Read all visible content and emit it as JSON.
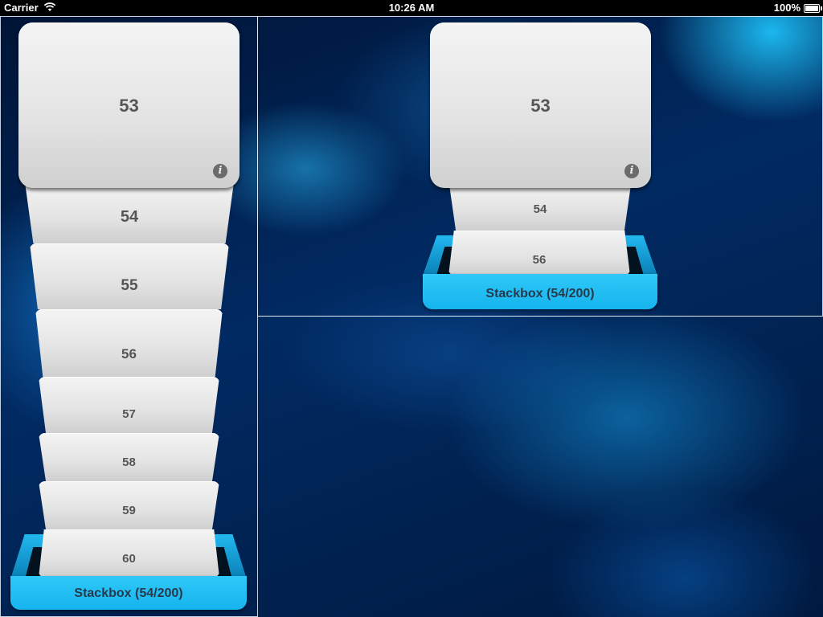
{
  "status_bar": {
    "carrier": "Carrier",
    "time": "10:26 AM",
    "battery": "100%"
  },
  "left_stack": {
    "cards": [
      {
        "label": "53"
      },
      {
        "label": "54"
      },
      {
        "label": "55"
      },
      {
        "label": "56"
      },
      {
        "label": "57"
      },
      {
        "label": "58"
      },
      {
        "label": "59"
      },
      {
        "label": "60"
      }
    ],
    "info_glyph": "i",
    "tray_label": "Stackbox (54/200)"
  },
  "right_stack": {
    "cards": [
      {
        "label": "53"
      },
      {
        "label": "54"
      },
      {
        "label": "56"
      }
    ],
    "info_glyph": "i",
    "tray_label": "Stackbox (54/200)"
  },
  "colors": {
    "tray": "#1fbef5",
    "card": "#e3e3e3",
    "background": "#012a62"
  },
  "icons": [
    "wifi-icon",
    "battery-icon",
    "info-icon"
  ]
}
